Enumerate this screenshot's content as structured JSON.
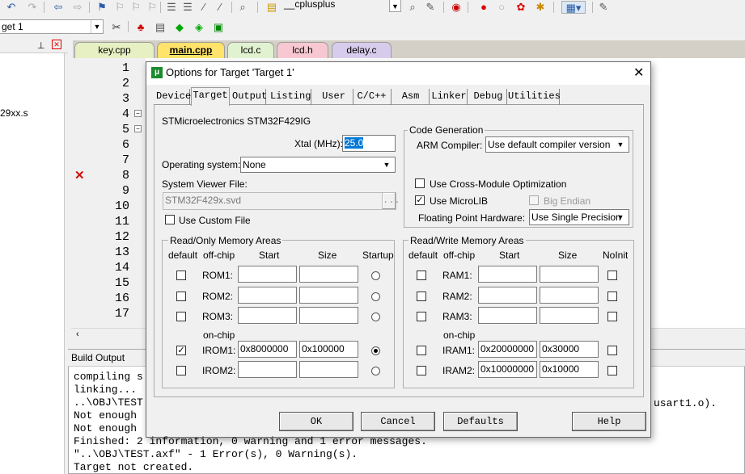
{
  "toolbar": {
    "target_value": "get 1",
    "project_combo": "__cplusplus"
  },
  "left_panel": {
    "file_label": "29xx.s"
  },
  "file_tabs": [
    "key.cpp",
    "main.cpp",
    "lcd.c",
    "lcd.h",
    "delay.c"
  ],
  "line_numbers": [
    "1",
    "2",
    "3",
    "4",
    "5",
    "6",
    "7",
    "8",
    "9",
    "10",
    "11",
    "12",
    "13",
    "14",
    "15",
    "16",
    "17"
  ],
  "build": {
    "title": "Build Output",
    "lines": [
      "compiling s",
      "linking...",
      "..\\OBJ\\TEST",
      "Not enough",
      "Not enough",
      "Finished: 2 information, 0 warning and 1 error messages.",
      "\"..\\OBJ\\TEST.axf\" - 1 Error(s), 0 Warning(s).",
      "Target not created."
    ],
    "right_fragment": "usart1.o)."
  },
  "dialog": {
    "title": "Options for Target 'Target 1'",
    "tabs": [
      "Device",
      "Target",
      "Output",
      "Listing",
      "User",
      "C/C++",
      "Asm",
      "Linker",
      "Debug",
      "Utilities"
    ],
    "device": "STMicroelectronics STM32F429IG",
    "xtal_label": "Xtal (MHz):",
    "xtal_value": "25.0",
    "os_label": "Operating system:",
    "os_value": "None",
    "svf_label": "System Viewer File:",
    "svf_value": "STM32F429x.svd",
    "browse": "...",
    "custom_file_label": "Use Custom File",
    "codegen": {
      "title": "Code Generation",
      "compiler_label": "ARM Compiler:",
      "compiler_value": "Use default compiler version",
      "cross_module": "Use Cross-Module Optimization",
      "microlib": "Use MicroLIB",
      "big_endian": "Big Endian",
      "fp_label": "Floating Point Hardware:",
      "fp_value": "Use Single Precision"
    },
    "ro": {
      "title": "Read/Only Memory Areas",
      "headers": [
        "default",
        "off-chip",
        "Start",
        "Size",
        "Startup"
      ],
      "on_chip": "on-chip",
      "rows": [
        {
          "name": "ROM1:",
          "start": "",
          "size": "",
          "default": false,
          "startup": false
        },
        {
          "name": "ROM2:",
          "start": "",
          "size": "",
          "default": false,
          "startup": false
        },
        {
          "name": "ROM3:",
          "start": "",
          "size": "",
          "default": false,
          "startup": false
        },
        {
          "name": "IROM1:",
          "start": "0x8000000",
          "size": "0x100000",
          "default": true,
          "startup": true
        },
        {
          "name": "IROM2:",
          "start": "",
          "size": "",
          "default": false,
          "startup": false
        }
      ]
    },
    "rw": {
      "title": "Read/Write Memory Areas",
      "headers": [
        "default",
        "off-chip",
        "Start",
        "Size",
        "NoInit"
      ],
      "on_chip": "on-chip",
      "rows": [
        {
          "name": "RAM1:",
          "start": "",
          "size": ""
        },
        {
          "name": "RAM2:",
          "start": "",
          "size": ""
        },
        {
          "name": "RAM3:",
          "start": "",
          "size": ""
        },
        {
          "name": "IRAM1:",
          "start": "0x20000000",
          "size": "0x30000"
        },
        {
          "name": "IRAM2:",
          "start": "0x10000000",
          "size": "0x10000"
        }
      ]
    },
    "buttons": {
      "ok": "OK",
      "cancel": "Cancel",
      "defaults": "Defaults",
      "help": "Help"
    },
    "checkmark": "✓"
  },
  "colors": {
    "accent": "#0078d7",
    "error": "#d01010",
    "active_tab": "#ffe36a"
  }
}
